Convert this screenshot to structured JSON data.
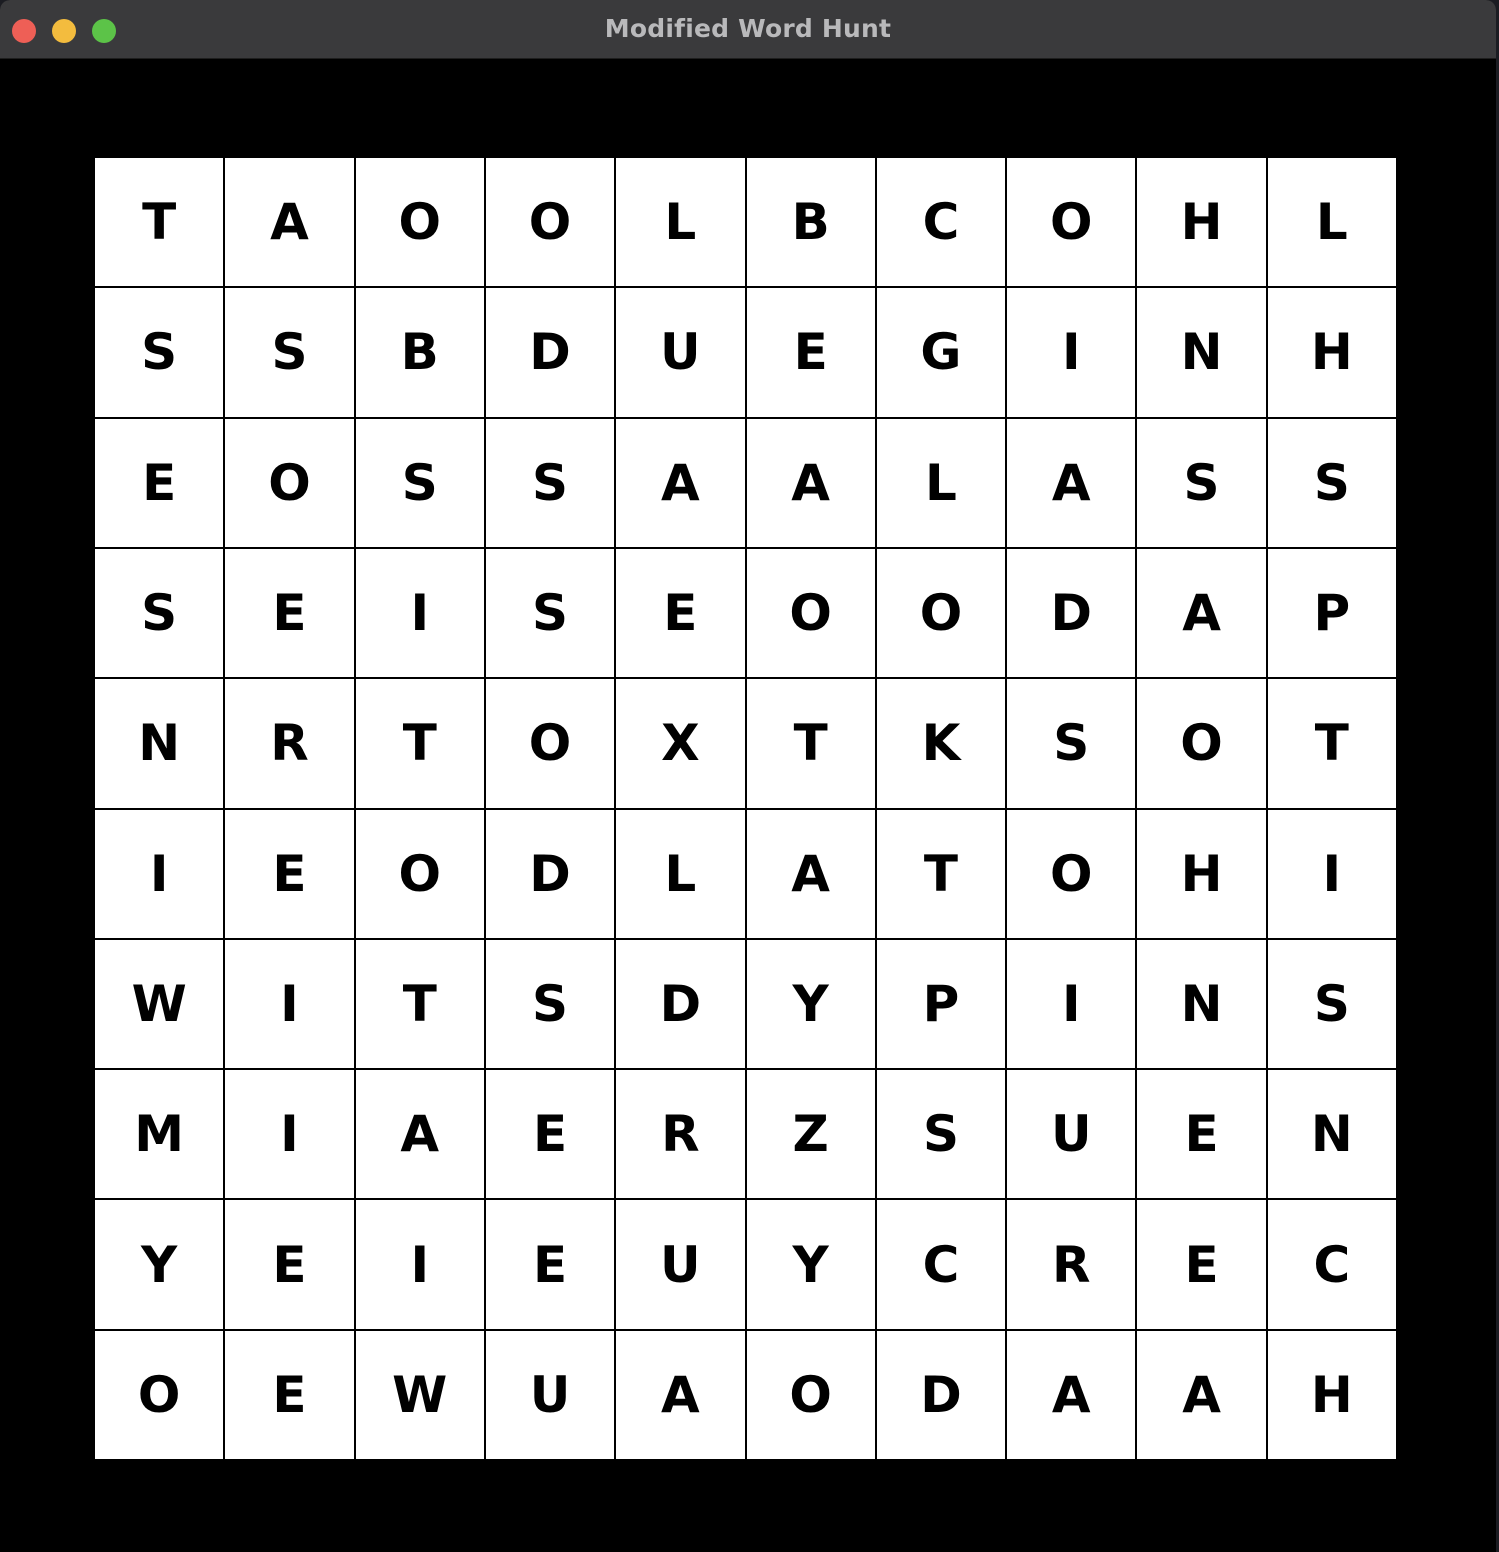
{
  "window": {
    "title": "Modified Word Hunt"
  },
  "grid": {
    "rows": [
      [
        "T",
        "A",
        "O",
        "O",
        "L",
        "B",
        "C",
        "O",
        "H",
        "L"
      ],
      [
        "S",
        "S",
        "B",
        "D",
        "U",
        "E",
        "G",
        "I",
        "N",
        "H"
      ],
      [
        "E",
        "O",
        "S",
        "S",
        "A",
        "A",
        "L",
        "A",
        "S",
        "S"
      ],
      [
        "S",
        "E",
        "I",
        "S",
        "E",
        "O",
        "O",
        "D",
        "A",
        "P"
      ],
      [
        "N",
        "R",
        "T",
        "O",
        "X",
        "T",
        "K",
        "S",
        "O",
        "T"
      ],
      [
        "I",
        "E",
        "O",
        "D",
        "L",
        "A",
        "T",
        "O",
        "H",
        "I"
      ],
      [
        "W",
        "I",
        "T",
        "S",
        "D",
        "Y",
        "P",
        "I",
        "N",
        "S"
      ],
      [
        "M",
        "I",
        "A",
        "E",
        "R",
        "Z",
        "S",
        "U",
        "E",
        "N"
      ],
      [
        "Y",
        "E",
        "I",
        "E",
        "U",
        "Y",
        "C",
        "R",
        "E",
        "C"
      ],
      [
        "O",
        "E",
        "W",
        "U",
        "A",
        "O",
        "D",
        "A",
        "A",
        "H"
      ]
    ]
  }
}
